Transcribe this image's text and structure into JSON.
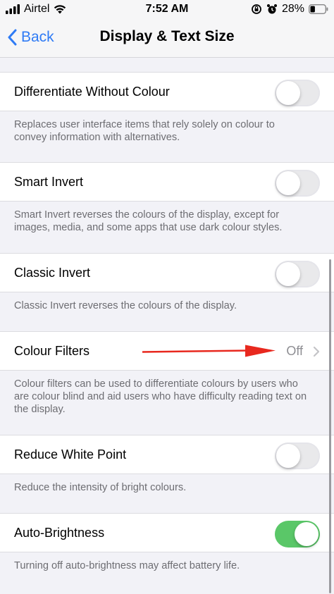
{
  "status_bar": {
    "carrier": "Airtel",
    "time": "7:52 AM",
    "battery": "28%"
  },
  "nav": {
    "back_label": "Back",
    "title": "Display & Text Size"
  },
  "settings": [
    {
      "label": "Differentiate Without Colour",
      "control": "toggle",
      "on": false,
      "footer": "Replaces user interface items that rely solely on colour to convey information with alternatives."
    },
    {
      "label": "Smart Invert",
      "control": "toggle",
      "on": false,
      "footer": "Smart Invert reverses the colours of the display, except for images, media, and some apps that use dark colour styles."
    },
    {
      "label": "Classic Invert",
      "control": "toggle",
      "on": false,
      "footer": "Classic Invert reverses the colours of the display."
    },
    {
      "label": "Colour Filters",
      "control": "disclosure",
      "value": "Off",
      "footer": "Colour filters can be used to differentiate colours by users who are colour blind and aid users who have difficulty reading text on the display."
    },
    {
      "label": "Reduce White Point",
      "control": "toggle",
      "on": false,
      "footer": "Reduce the intensity of bright colours."
    },
    {
      "label": "Auto-Brightness",
      "control": "toggle",
      "on": true,
      "footer": "Turning off auto-brightness may affect battery life."
    }
  ],
  "colors": {
    "accent": "#2f7bf5",
    "toggle_on": "#5ac768",
    "annotation_arrow": "#e8281e"
  },
  "icons": [
    "signal-bars-icon",
    "wifi-icon",
    "back-chevron-icon",
    "orientation-lock-icon",
    "alarm-icon",
    "battery-icon",
    "chevron-right-icon",
    "annotation-arrow-icon"
  ]
}
